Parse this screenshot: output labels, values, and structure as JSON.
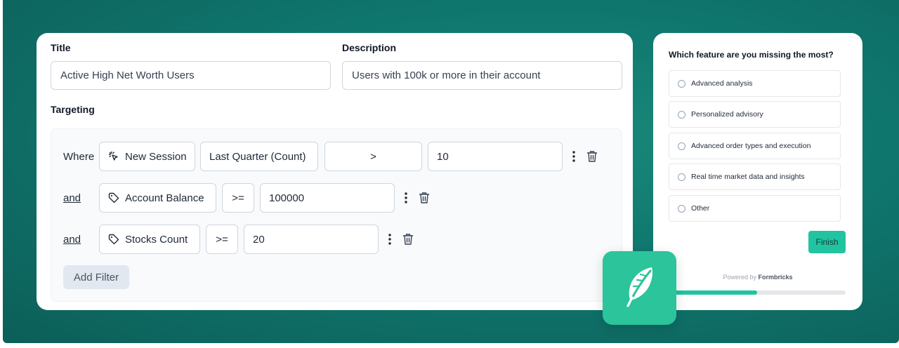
{
  "segment": {
    "title_label": "Title",
    "title_value": "Active High Net Worth Users",
    "description_label": "Description",
    "description_value": "Users with 100k or more in their account",
    "targeting_label": "Targeting",
    "filters": [
      {
        "connector": "Where",
        "attribute": "New Session",
        "attribute_icon": "cursor-click-icon",
        "qualifier": "Last Quarter (Count)",
        "operator": ">",
        "value": "10"
      },
      {
        "connector": "and",
        "attribute": "Account Balance",
        "attribute_icon": "tag-icon",
        "operator": ">=",
        "value": "100000"
      },
      {
        "connector": "and",
        "attribute": "Stocks Count",
        "attribute_icon": "tag-icon",
        "operator": ">=",
        "value": "20"
      }
    ],
    "add_filter_label": "Add Filter"
  },
  "survey": {
    "question": "Which feature are you missing the most?",
    "options": [
      "Advanced analysis",
      "Personalized advisory",
      "Advanced order types and execution",
      "Real time market data and insights",
      "Other"
    ],
    "finish_label": "Finish",
    "powered_by_prefix": "Powered by",
    "powered_by_brand": "Formbricks",
    "progress": 0.5,
    "accent_color": "#22c3a0"
  },
  "logo": {
    "icon": "feather-logo-icon",
    "color": "#2cc49a"
  }
}
